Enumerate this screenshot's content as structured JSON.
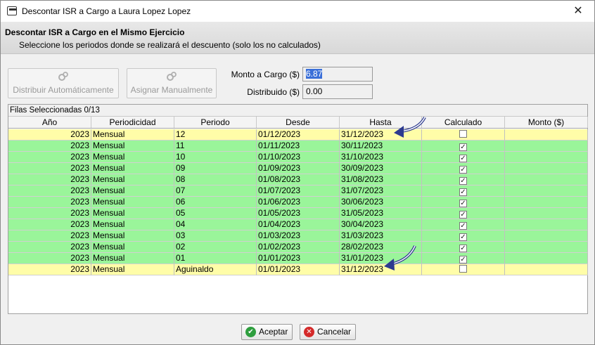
{
  "window": {
    "title": "Descontar ISR a Cargo a Laura Lopez Lopez",
    "close_glyph": "✕"
  },
  "header": {
    "title": "Descontar ISR a Cargo en el Mismo Ejercicio",
    "subtitle": "Seleccione los periodos donde se realizará el descuento (solo los no calculados)"
  },
  "toolbar": {
    "distribuir_label": "Distribuir Automáticamente",
    "asignar_label": "Asignar Manualmente"
  },
  "form": {
    "monto_label": "Monto a Cargo ($)",
    "monto_value": "6.87",
    "distribuido_label": "Distribuido ($)",
    "distribuido_value": "0.00"
  },
  "grid": {
    "caption": "Filas Seleccionadas  0/13",
    "columns": [
      "Año",
      "Periodicidad",
      "Periodo",
      "Desde",
      "Hasta",
      "Calculado",
      "Monto ($)"
    ],
    "rows": [
      {
        "anio": "2023",
        "periodicidad": "Mensual",
        "periodo": "12",
        "desde": "01/12/2023",
        "hasta": "31/12/2023",
        "calculado": false,
        "monto": ""
      },
      {
        "anio": "2023",
        "periodicidad": "Mensual",
        "periodo": "11",
        "desde": "01/11/2023",
        "hasta": "30/11/2023",
        "calculado": true,
        "monto": ""
      },
      {
        "anio": "2023",
        "periodicidad": "Mensual",
        "periodo": "10",
        "desde": "01/10/2023",
        "hasta": "31/10/2023",
        "calculado": true,
        "monto": ""
      },
      {
        "anio": "2023",
        "periodicidad": "Mensual",
        "periodo": "09",
        "desde": "01/09/2023",
        "hasta": "30/09/2023",
        "calculado": true,
        "monto": ""
      },
      {
        "anio": "2023",
        "periodicidad": "Mensual",
        "periodo": "08",
        "desde": "01/08/2023",
        "hasta": "31/08/2023",
        "calculado": true,
        "monto": ""
      },
      {
        "anio": "2023",
        "periodicidad": "Mensual",
        "periodo": "07",
        "desde": "01/07/2023",
        "hasta": "31/07/2023",
        "calculado": true,
        "monto": ""
      },
      {
        "anio": "2023",
        "periodicidad": "Mensual",
        "periodo": "06",
        "desde": "01/06/2023",
        "hasta": "30/06/2023",
        "calculado": true,
        "monto": ""
      },
      {
        "anio": "2023",
        "periodicidad": "Mensual",
        "periodo": "05",
        "desde": "01/05/2023",
        "hasta": "31/05/2023",
        "calculado": true,
        "monto": ""
      },
      {
        "anio": "2023",
        "periodicidad": "Mensual",
        "periodo": "04",
        "desde": "01/04/2023",
        "hasta": "30/04/2023",
        "calculado": true,
        "monto": ""
      },
      {
        "anio": "2023",
        "periodicidad": "Mensual",
        "periodo": "03",
        "desde": "01/03/2023",
        "hasta": "31/03/2023",
        "calculado": true,
        "monto": ""
      },
      {
        "anio": "2023",
        "periodicidad": "Mensual",
        "periodo": "02",
        "desde": "01/02/2023",
        "hasta": "28/02/2023",
        "calculado": true,
        "monto": ""
      },
      {
        "anio": "2023",
        "periodicidad": "Mensual",
        "periodo": "01",
        "desde": "01/01/2023",
        "hasta": "31/01/2023",
        "calculado": true,
        "monto": ""
      },
      {
        "anio": "2023",
        "periodicidad": "Mensual",
        "periodo": "Aguinaldo",
        "desde": "01/01/2023",
        "hasta": "31/12/2023",
        "calculado": false,
        "monto": ""
      }
    ]
  },
  "footer": {
    "accept_label": "Aceptar",
    "cancel_label": "Cancelar"
  },
  "colors": {
    "row_uncalculated": "#fffda8",
    "row_calculated": "#9af59a",
    "accept_icon": "#2e9e3e",
    "cancel_icon": "#d42a2a",
    "arrow": "#2d3a8f"
  },
  "icons": {
    "distribuir": "cogs-icon",
    "asignar": "cogs-icon",
    "accept": "check-circle-icon",
    "cancel": "x-circle-icon",
    "app": "window-icon"
  }
}
